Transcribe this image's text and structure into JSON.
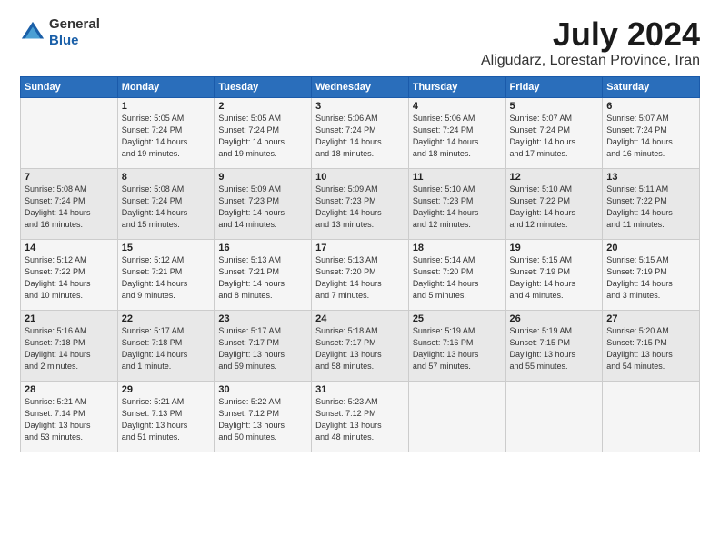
{
  "logo": {
    "general": "General",
    "blue": "Blue"
  },
  "title": "July 2024",
  "location": "Aligudarz, Lorestan Province, Iran",
  "days_of_week": [
    "Sunday",
    "Monday",
    "Tuesday",
    "Wednesday",
    "Thursday",
    "Friday",
    "Saturday"
  ],
  "weeks": [
    [
      {
        "day": "",
        "info": ""
      },
      {
        "day": "1",
        "info": "Sunrise: 5:05 AM\nSunset: 7:24 PM\nDaylight: 14 hours\nand 19 minutes."
      },
      {
        "day": "2",
        "info": "Sunrise: 5:05 AM\nSunset: 7:24 PM\nDaylight: 14 hours\nand 19 minutes."
      },
      {
        "day": "3",
        "info": "Sunrise: 5:06 AM\nSunset: 7:24 PM\nDaylight: 14 hours\nand 18 minutes."
      },
      {
        "day": "4",
        "info": "Sunrise: 5:06 AM\nSunset: 7:24 PM\nDaylight: 14 hours\nand 18 minutes."
      },
      {
        "day": "5",
        "info": "Sunrise: 5:07 AM\nSunset: 7:24 PM\nDaylight: 14 hours\nand 17 minutes."
      },
      {
        "day": "6",
        "info": "Sunrise: 5:07 AM\nSunset: 7:24 PM\nDaylight: 14 hours\nand 16 minutes."
      }
    ],
    [
      {
        "day": "7",
        "info": "Sunrise: 5:08 AM\nSunset: 7:24 PM\nDaylight: 14 hours\nand 16 minutes."
      },
      {
        "day": "8",
        "info": "Sunrise: 5:08 AM\nSunset: 7:24 PM\nDaylight: 14 hours\nand 15 minutes."
      },
      {
        "day": "9",
        "info": "Sunrise: 5:09 AM\nSunset: 7:23 PM\nDaylight: 14 hours\nand 14 minutes."
      },
      {
        "day": "10",
        "info": "Sunrise: 5:09 AM\nSunset: 7:23 PM\nDaylight: 14 hours\nand 13 minutes."
      },
      {
        "day": "11",
        "info": "Sunrise: 5:10 AM\nSunset: 7:23 PM\nDaylight: 14 hours\nand 12 minutes."
      },
      {
        "day": "12",
        "info": "Sunrise: 5:10 AM\nSunset: 7:22 PM\nDaylight: 14 hours\nand 12 minutes."
      },
      {
        "day": "13",
        "info": "Sunrise: 5:11 AM\nSunset: 7:22 PM\nDaylight: 14 hours\nand 11 minutes."
      }
    ],
    [
      {
        "day": "14",
        "info": "Sunrise: 5:12 AM\nSunset: 7:22 PM\nDaylight: 14 hours\nand 10 minutes."
      },
      {
        "day": "15",
        "info": "Sunrise: 5:12 AM\nSunset: 7:21 PM\nDaylight: 14 hours\nand 9 minutes."
      },
      {
        "day": "16",
        "info": "Sunrise: 5:13 AM\nSunset: 7:21 PM\nDaylight: 14 hours\nand 8 minutes."
      },
      {
        "day": "17",
        "info": "Sunrise: 5:13 AM\nSunset: 7:20 PM\nDaylight: 14 hours\nand 7 minutes."
      },
      {
        "day": "18",
        "info": "Sunrise: 5:14 AM\nSunset: 7:20 PM\nDaylight: 14 hours\nand 5 minutes."
      },
      {
        "day": "19",
        "info": "Sunrise: 5:15 AM\nSunset: 7:19 PM\nDaylight: 14 hours\nand 4 minutes."
      },
      {
        "day": "20",
        "info": "Sunrise: 5:15 AM\nSunset: 7:19 PM\nDaylight: 14 hours\nand 3 minutes."
      }
    ],
    [
      {
        "day": "21",
        "info": "Sunrise: 5:16 AM\nSunset: 7:18 PM\nDaylight: 14 hours\nand 2 minutes."
      },
      {
        "day": "22",
        "info": "Sunrise: 5:17 AM\nSunset: 7:18 PM\nDaylight: 14 hours\nand 1 minute."
      },
      {
        "day": "23",
        "info": "Sunrise: 5:17 AM\nSunset: 7:17 PM\nDaylight: 13 hours\nand 59 minutes."
      },
      {
        "day": "24",
        "info": "Sunrise: 5:18 AM\nSunset: 7:17 PM\nDaylight: 13 hours\nand 58 minutes."
      },
      {
        "day": "25",
        "info": "Sunrise: 5:19 AM\nSunset: 7:16 PM\nDaylight: 13 hours\nand 57 minutes."
      },
      {
        "day": "26",
        "info": "Sunrise: 5:19 AM\nSunset: 7:15 PM\nDaylight: 13 hours\nand 55 minutes."
      },
      {
        "day": "27",
        "info": "Sunrise: 5:20 AM\nSunset: 7:15 PM\nDaylight: 13 hours\nand 54 minutes."
      }
    ],
    [
      {
        "day": "28",
        "info": "Sunrise: 5:21 AM\nSunset: 7:14 PM\nDaylight: 13 hours\nand 53 minutes."
      },
      {
        "day": "29",
        "info": "Sunrise: 5:21 AM\nSunset: 7:13 PM\nDaylight: 13 hours\nand 51 minutes."
      },
      {
        "day": "30",
        "info": "Sunrise: 5:22 AM\nSunset: 7:12 PM\nDaylight: 13 hours\nand 50 minutes."
      },
      {
        "day": "31",
        "info": "Sunrise: 5:23 AM\nSunset: 7:12 PM\nDaylight: 13 hours\nand 48 minutes."
      },
      {
        "day": "",
        "info": ""
      },
      {
        "day": "",
        "info": ""
      },
      {
        "day": "",
        "info": ""
      }
    ]
  ]
}
